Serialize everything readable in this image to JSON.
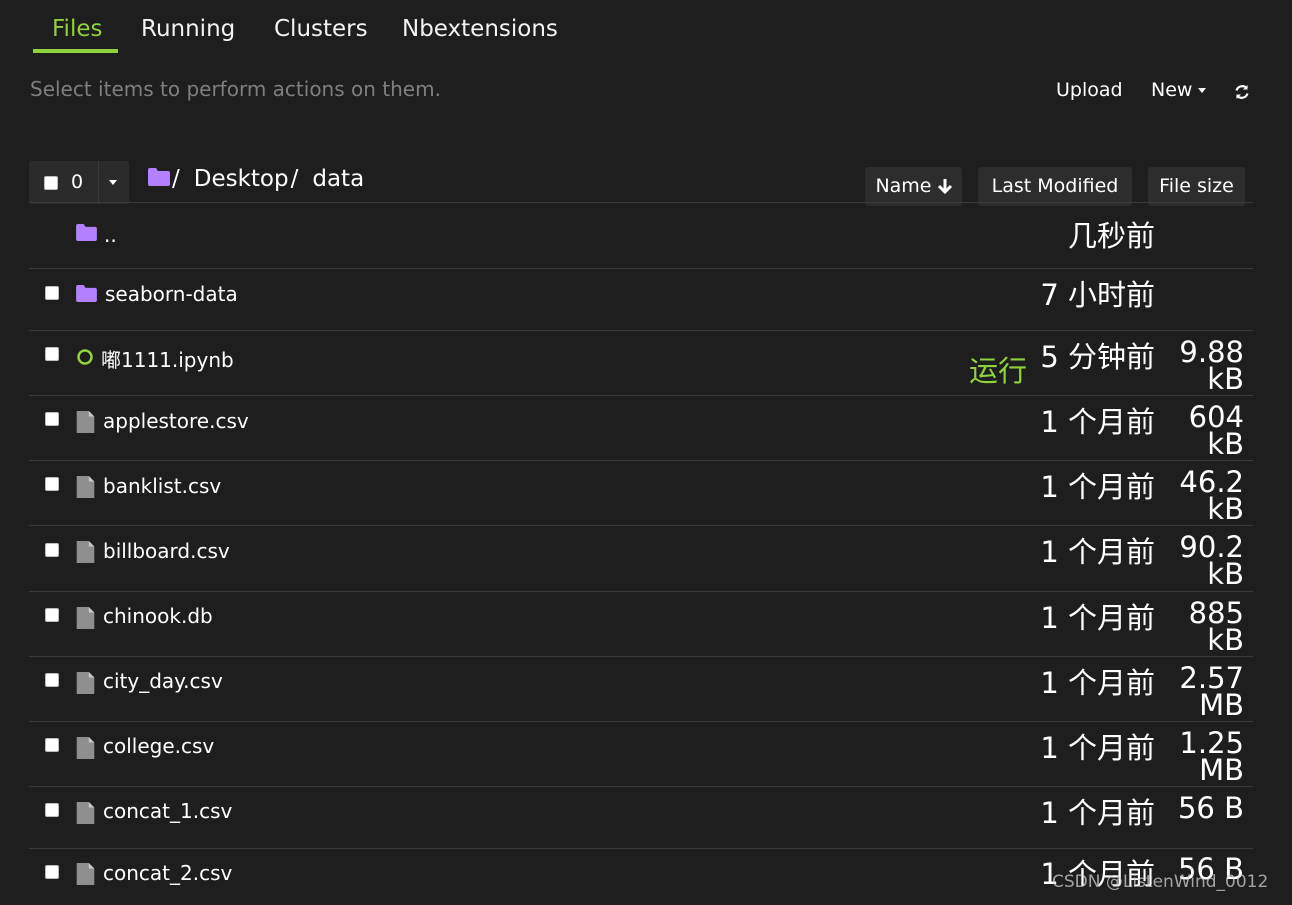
{
  "tabs": [
    {
      "label": "Files",
      "active": true
    },
    {
      "label": "Running",
      "active": false
    },
    {
      "label": "Clusters",
      "active": false
    },
    {
      "label": "Nbextensions",
      "active": false
    }
  ],
  "hint": "Select items to perform actions on them.",
  "toolbar": {
    "upload_label": "Upload",
    "new_label": "New",
    "refresh_icon": "refresh-icon"
  },
  "selection": {
    "count": "0"
  },
  "breadcrumb": {
    "root_icon": "folder-icon",
    "separator": "/",
    "items": [
      "Desktop",
      "data"
    ]
  },
  "sort": {
    "name_label": "Name",
    "name_direction_icon": "arrow-down-icon",
    "modified_label": "Last Modified",
    "size_label": "File size"
  },
  "colors": {
    "accent": "#8fd13f",
    "folder": "#b380ff",
    "file": "#8f8f8f",
    "background": "#1e1e1e"
  },
  "rows": [
    {
      "name": "..",
      "type": "parent-folder",
      "icon": "folder-icon",
      "modified": "几秒前",
      "size": ""
    },
    {
      "name": "seaborn-data",
      "type": "folder",
      "icon": "folder-icon",
      "modified": "7 小时前",
      "size": ""
    },
    {
      "name": "嘟1111.ipynb",
      "type": "notebook",
      "icon": "notebook-running-icon",
      "status": "运行",
      "modified": "5 分钟前",
      "size_value": "9.88",
      "size_unit": "kB"
    },
    {
      "name": "applestore.csv",
      "type": "file",
      "icon": "file-icon",
      "modified": "1 个月前",
      "size_value": "604",
      "size_unit": "kB"
    },
    {
      "name": "banklist.csv",
      "type": "file",
      "icon": "file-icon",
      "modified": "1 个月前",
      "size_value": "46.2",
      "size_unit": "kB"
    },
    {
      "name": "billboard.csv",
      "type": "file",
      "icon": "file-icon",
      "modified": "1 个月前",
      "size_value": "90.2",
      "size_unit": "kB"
    },
    {
      "name": "chinook.db",
      "type": "file",
      "icon": "file-icon",
      "modified": "1 个月前",
      "size_value": "885",
      "size_unit": "kB"
    },
    {
      "name": "city_day.csv",
      "type": "file",
      "icon": "file-icon",
      "modified": "1 个月前",
      "size_value": "2.57",
      "size_unit": "MB"
    },
    {
      "name": "college.csv",
      "type": "file",
      "icon": "file-icon",
      "modified": "1 个月前",
      "size_value": "1.25",
      "size_unit": "MB"
    },
    {
      "name": "concat_1.csv",
      "type": "file",
      "icon": "file-icon",
      "modified": "1 个月前",
      "size_value": "56 B",
      "size_unit": ""
    },
    {
      "name": "concat_2.csv",
      "type": "file",
      "icon": "file-icon",
      "modified": "1 个月前",
      "size_value": "56 B",
      "size_unit": ""
    }
  ],
  "watermark": "CSDN @ListenWind_0012"
}
